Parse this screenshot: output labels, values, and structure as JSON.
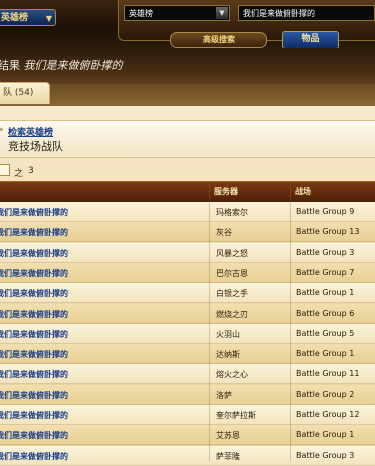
{
  "header": {
    "category_select": "英雄榜",
    "realm_select": "英雄榜",
    "search_value": "我们是来做俯卧撑的",
    "advanced_search_label": "高级搜索",
    "items_button_label": "物品"
  },
  "results": {
    "title_prefix": "结果",
    "title_query": "我们是来做俯卧撑的"
  },
  "tabs": {
    "guild_tab_label": "队 (54)"
  },
  "breadcrumb": {
    "link_label": "检索英雄榜",
    "current_label": "竞技场战队"
  },
  "pager": {
    "of_label": "之",
    "total_pages": "3"
  },
  "table": {
    "columns": {
      "server": "服务器",
      "battlegroup": "战场"
    },
    "rows": [
      {
        "team": "我们是来做俯卧撑的",
        "server": "玛格索尔",
        "battlegroup": "Battle Group 9"
      },
      {
        "team": "我们是来做俯卧撑的",
        "server": "灰谷",
        "battlegroup": "Battle Group 13"
      },
      {
        "team": "我们是来做俯卧撑的",
        "server": "风暴之怒",
        "battlegroup": "Battle Group 3"
      },
      {
        "team": "我们是来做俯卧撑的",
        "server": "巴尔古恩",
        "battlegroup": "Battle Group 7"
      },
      {
        "team": "我们是来做俯卧撑的",
        "server": "白银之手",
        "battlegroup": "Battle Group 1"
      },
      {
        "team": "我们是来做俯卧撑的",
        "server": "燃烧之刃",
        "battlegroup": "Battle Group 6"
      },
      {
        "team": "我们是来做俯卧撑的",
        "server": "火羽山",
        "battlegroup": "Battle Group 5"
      },
      {
        "team": "我们是来做俯卧撑的",
        "server": "达纳斯",
        "battlegroup": "Battle Group 1"
      },
      {
        "team": "我们是来做俯卧撑的",
        "server": "熔火之心",
        "battlegroup": "Battle Group 11"
      },
      {
        "team": "我们是来做俯卧撑的",
        "server": "洛萨",
        "battlegroup": "Battle Group 2"
      },
      {
        "team": "我们是来做俯卧撑的",
        "server": "奎尔萨拉斯",
        "battlegroup": "Battle Group 12"
      },
      {
        "team": "我们是来做俯卧撑的",
        "server": "艾苏恩",
        "battlegroup": "Battle Group 1"
      },
      {
        "team": "我们是来做俯卧撑的",
        "server": "萨菲隆",
        "battlegroup": "Battle Group 3"
      }
    ]
  }
}
